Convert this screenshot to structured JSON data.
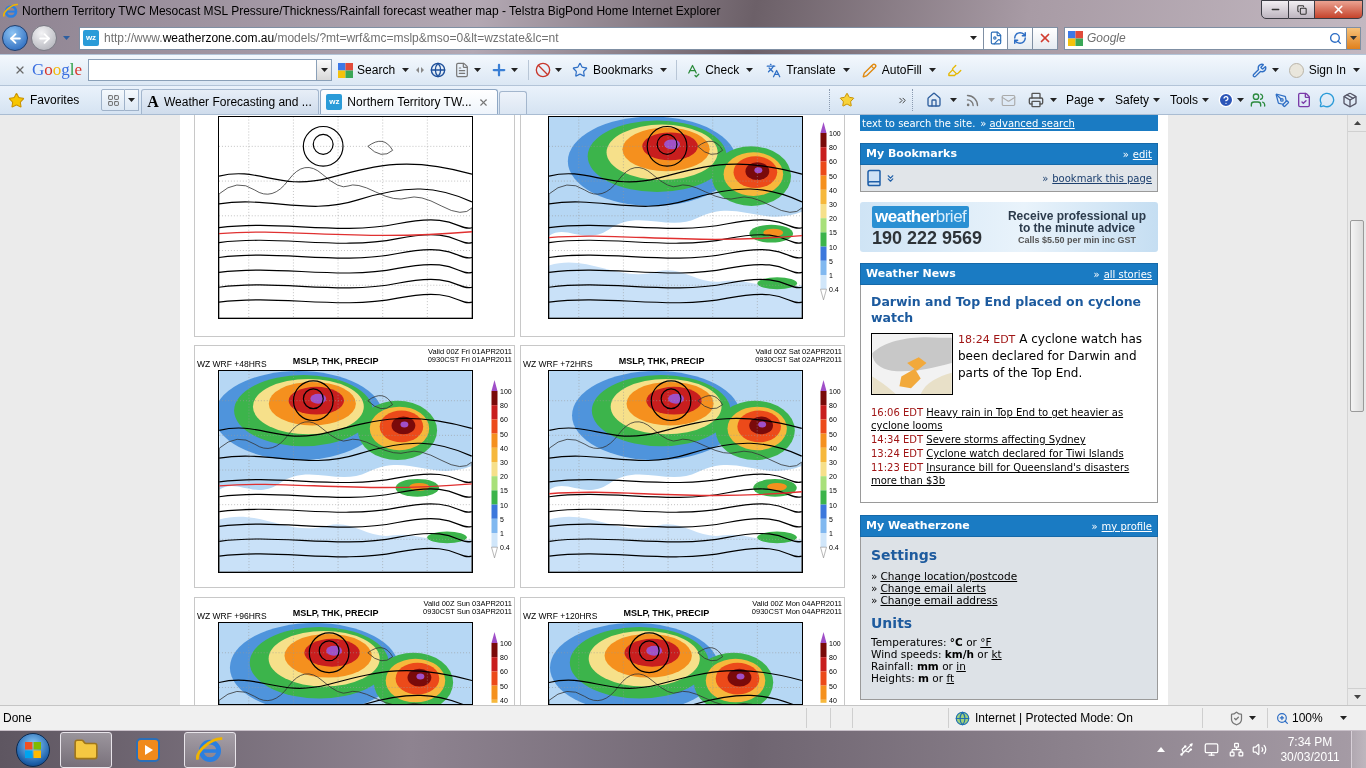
{
  "window": {
    "title": "Northern Territory TWC Mesocast MSL Pressure/Thickness/Rainfall forecast weather map - Telstra BigPond Home Internet Explorer"
  },
  "address_bar": {
    "favicon": {
      "kind": "tile",
      "text": "wz"
    },
    "url_scheme": "http://www.",
    "url_host": "weatherzone.com.au",
    "url_path": "/models/?mt=wrf&mc=mslp&mso=0&lt=wzstate&lc=nt"
  },
  "search_box": {
    "placeholder": "Google"
  },
  "google_toolbar": {
    "logo": "Google",
    "search_button": "Search",
    "buttons": [
      "Bookmarks",
      "Check",
      "Translate",
      "AutoFill"
    ],
    "sign_in": "Sign In"
  },
  "favorites_bar": {
    "favorites": "Favorites",
    "tabs": [
      {
        "favicon": {
          "kind": "letter",
          "text": "A"
        },
        "label": "Weather Forecasting and ...",
        "selected": false
      },
      {
        "favicon": {
          "kind": "tile",
          "text": "wz"
        },
        "label": "Northern Territory TW...",
        "selected": true
      }
    ],
    "menus": [
      "Page",
      "Safety",
      "Tools"
    ]
  },
  "map_rows": [
    {
      "panels": [
        {
          "kind": "plain"
        },
        {
          "kind": "precip",
          "colorbar": [
            "100",
            "80",
            "60",
            "50",
            "40",
            "30",
            "20",
            "15",
            "10",
            "5",
            "1",
            "0.4"
          ]
        }
      ]
    },
    {
      "panels": [
        {
          "kind": "precip",
          "run": "WZ WRF +48HRS",
          "title": "MSLP, THK, PRECIP",
          "valid": "Valid 00Z Fri 01APR2011",
          "local": "0930CST Fri 01APR2011",
          "colorbar": [
            "100",
            "80",
            "60",
            "50",
            "40",
            "30",
            "20",
            "15",
            "10",
            "5",
            "1",
            "0.4"
          ]
        },
        {
          "kind": "precip",
          "run": "WZ WRF +72HRS",
          "title": "MSLP, THK, PRECIP",
          "valid": "Valid 00Z Sat 02APR2011",
          "local": "0930CST Sat 02APR2011",
          "colorbar": [
            "100",
            "80",
            "60",
            "50",
            "40",
            "30",
            "20",
            "15",
            "10",
            "5",
            "1",
            "0.4"
          ]
        }
      ]
    },
    {
      "panels": [
        {
          "kind": "precip",
          "run": "WZ WRF +96HRS",
          "title": "MSLP, THK, PRECIP",
          "valid": "Valid 00Z Sun 03APR2011",
          "local": "0930CST Sun 03APR2011",
          "colorbar": [
            "100",
            "80",
            "60",
            "50",
            "40"
          ]
        },
        {
          "kind": "precip",
          "run": "WZ WRF +120HRS",
          "title": "MSLP, THK, PRECIP",
          "valid": "Valid 00Z Mon 04APR2011",
          "local": "0930CST Mon 04APR2011",
          "colorbar": [
            "100",
            "80",
            "60",
            "50",
            "40"
          ]
        }
      ]
    }
  ],
  "sidebar": {
    "search_note": {
      "text": "text to search the site.",
      "link_prefix": "»",
      "link": "advanced search"
    },
    "bookmarks": {
      "title": "My Bookmarks",
      "action_prefix": "»",
      "action": "edit",
      "link_prefix": "»",
      "link": "bookmark this page"
    },
    "ad": {
      "logo_main": "weather",
      "logo_accent": "brief",
      "phone": "190 222 9569",
      "headline": [
        "Receive professional up",
        "to the minute advice"
      ],
      "rates": "Calls $5.50 per min inc GST"
    },
    "news": {
      "title": "Weather News",
      "action_prefix": "»",
      "action": "all stories",
      "headline": "Darwin and Top End placed on cyclone watch",
      "lead_time": "18:24 EDT",
      "lead_text": "A cyclone watch has been declared for Darwin and parts of the Top End.",
      "items": [
        {
          "time": "16:06 EDT",
          "title": "Heavy rain in Top End to get heavier as cyclone looms"
        },
        {
          "time": "14:34 EDT",
          "title": "Severe storms affecting Sydney"
        },
        {
          "time": "13:24 EDT",
          "title": "Cyclone watch declared for Tiwi Islands"
        },
        {
          "time": "11:23 EDT",
          "title": "Insurance bill for Queensland's disasters more than $3b"
        }
      ]
    },
    "my_weatherzone": {
      "title": "My Weatherzone",
      "action_prefix": "»",
      "action": "my profile",
      "settings_heading": "Settings",
      "settings_links": [
        {
          "prefix": "»",
          "label": "Change location/postcode"
        },
        {
          "prefix": "»",
          "label": "Change email alerts"
        },
        {
          "prefix": "»",
          "label": "Change email address"
        }
      ],
      "units_heading": "Units",
      "units": [
        {
          "text": "Temperatures: **°C** or",
          "link": "°F"
        },
        {
          "text": "Wind speeds: **km/h** or",
          "link": "kt"
        },
        {
          "text": "Rainfall: **mm** or",
          "link": "in"
        },
        {
          "text": "Heights: **m** or",
          "link": "ft"
        }
      ]
    }
  },
  "status_bar": {
    "status": "Done",
    "zone": "Internet | Protected Mode: On",
    "zoom": "100%"
  },
  "taskbar": {
    "apps": [
      {
        "running": true
      },
      {
        "running": false
      },
      {
        "running": true
      }
    ],
    "time": "7:34 PM",
    "date": "30/03/2011"
  }
}
